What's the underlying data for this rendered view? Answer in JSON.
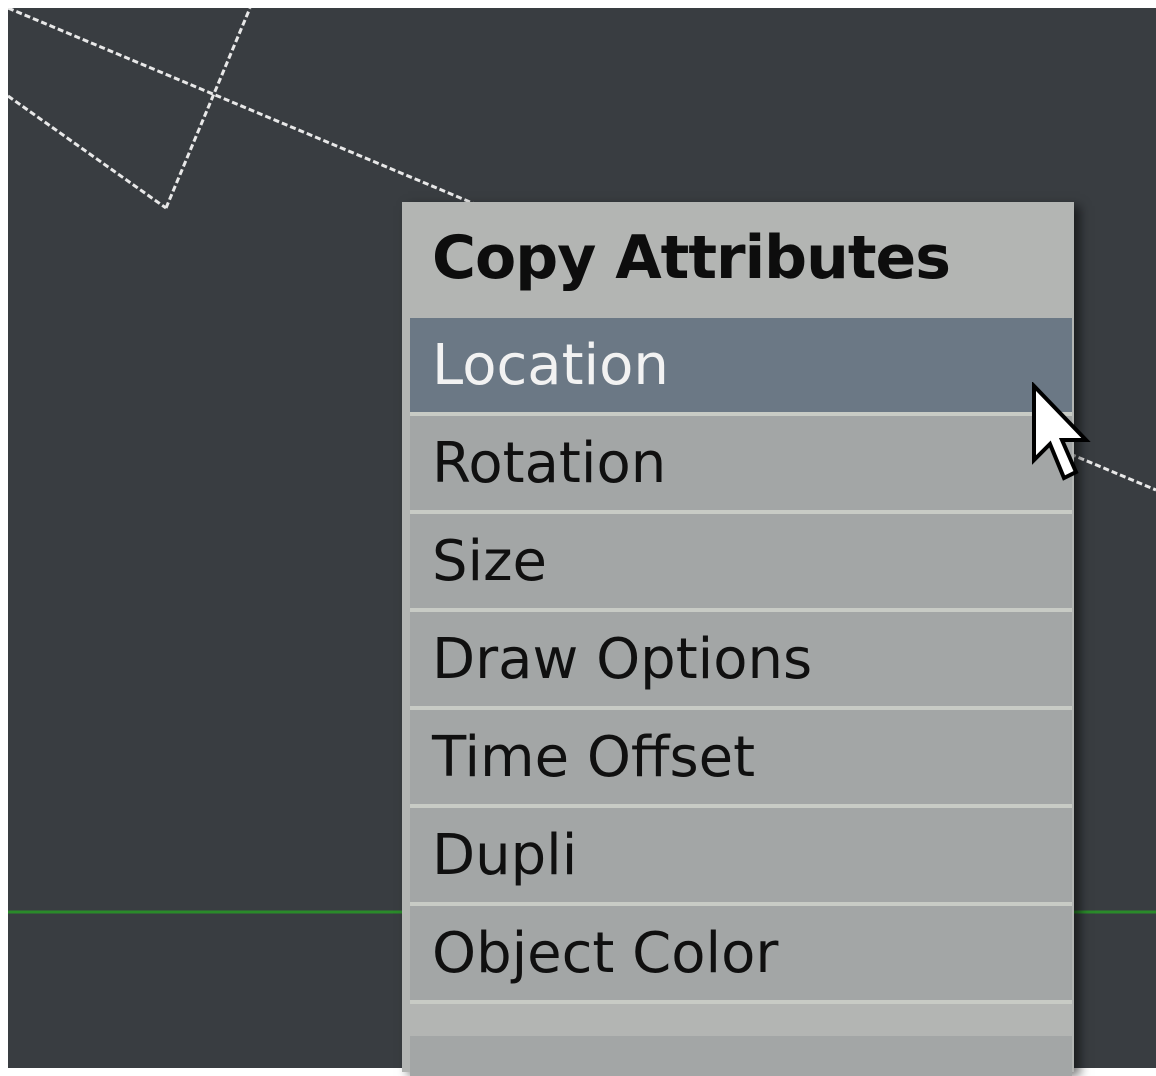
{
  "viewport": {
    "background": "#393d41",
    "wire_color": "#e8e8e8",
    "axis_color": "#2a8a2a"
  },
  "menu": {
    "title": "Copy Attributes",
    "highlight_color": "#6b7885",
    "items": [
      {
        "label": "Location",
        "active": true
      },
      {
        "label": "Rotation",
        "active": false
      },
      {
        "label": "Size",
        "active": false
      },
      {
        "label": "Draw Options",
        "active": false
      },
      {
        "label": "Time Offset",
        "active": false
      },
      {
        "label": "Dupli",
        "active": false
      },
      {
        "label": "Object Color",
        "active": false
      }
    ]
  },
  "cursor": {
    "icon": "arrow-pointer-icon"
  }
}
